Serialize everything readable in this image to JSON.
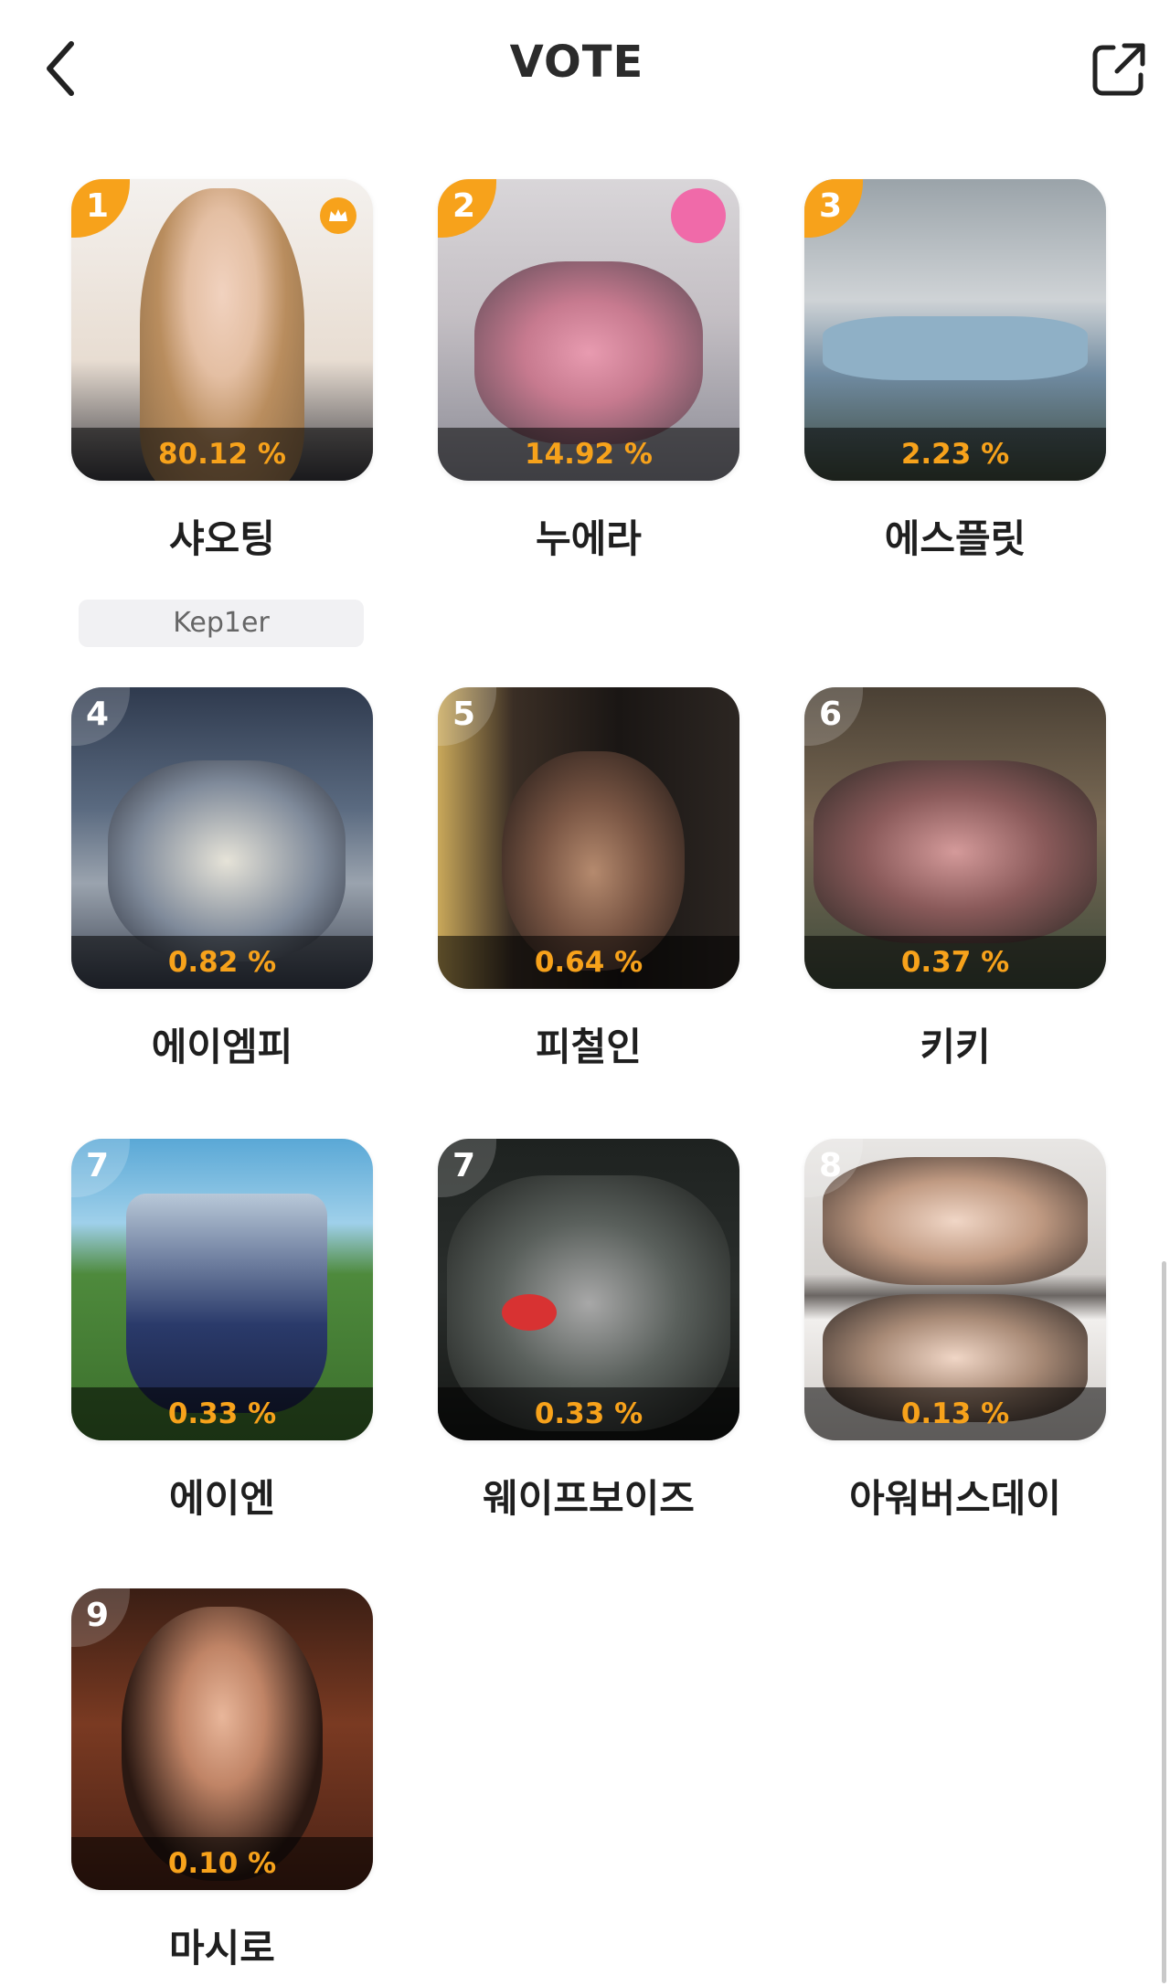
{
  "header": {
    "title": "VOTE",
    "back_icon": "chevron-left-icon",
    "share_icon": "external-share-icon"
  },
  "colors": {
    "accent": "#f7a21b",
    "text_dark": "#1f1f1f",
    "tag_bg": "#f1f1f3"
  },
  "candidates": [
    {
      "rank": "1",
      "percent": "80.12 %",
      "name": "샤오팅",
      "group": "Kep1er",
      "crown": true
    },
    {
      "rank": "2",
      "percent": "14.92 %",
      "name": "누에라"
    },
    {
      "rank": "3",
      "percent": "2.23 %",
      "name": "에스플릿"
    },
    {
      "rank": "4",
      "percent": "0.82 %",
      "name": "에이엠피"
    },
    {
      "rank": "5",
      "percent": "0.64 %",
      "name": "피철인"
    },
    {
      "rank": "6",
      "percent": "0.37 %",
      "name": "키키"
    },
    {
      "rank": "7",
      "percent": "0.33 %",
      "name": "에이엔"
    },
    {
      "rank": "7",
      "percent": "0.33 %",
      "name": "웨이프보이즈"
    },
    {
      "rank": "8",
      "percent": "0.13 %",
      "name": "아워버스데이"
    },
    {
      "rank": "9",
      "percent": "0.10 %",
      "name": "마시로"
    }
  ]
}
